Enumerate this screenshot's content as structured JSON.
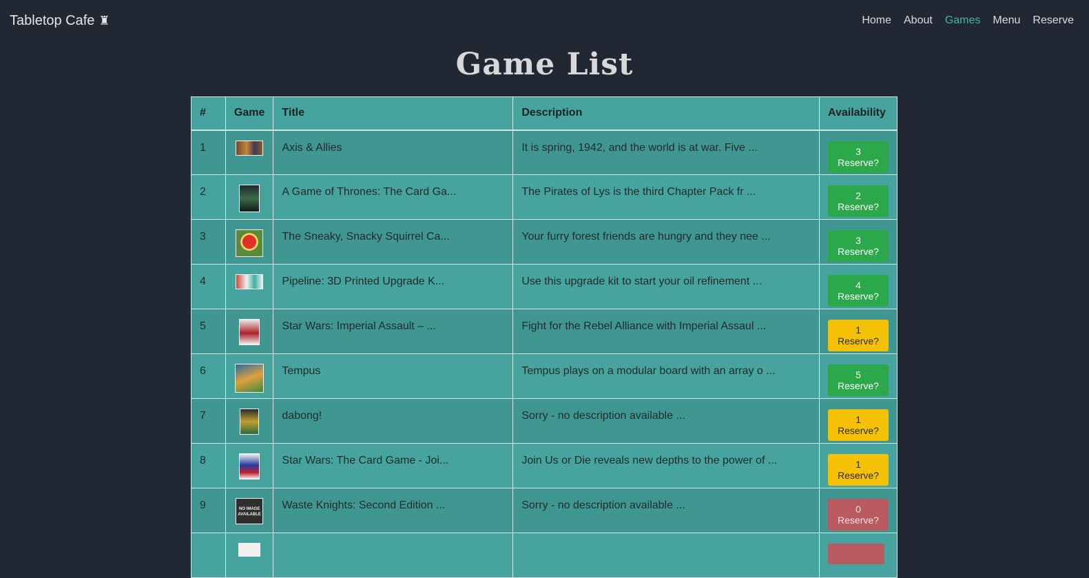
{
  "navbar": {
    "brand": "Tabletop Cafe",
    "brand_icon": "rook-castle-icon",
    "links": [
      "Home",
      "About",
      "Games",
      "Menu",
      "Reserve"
    ],
    "active": "Games"
  },
  "page_title": "Game List",
  "table": {
    "headers": [
      "#",
      "Game",
      "Title",
      "Description",
      "Availability"
    ],
    "rows": [
      {
        "num": "1",
        "title": "Axis & Allies",
        "description": "It is spring, 1942, and the world is at war. Five ...",
        "availability": "3 Reserve?",
        "status": "success"
      },
      {
        "num": "2",
        "title": "A Game of Thrones: The Card Ga...",
        "description": "The Pirates of Lys is the third Chapter Pack fr ...",
        "availability": "2 Reserve?",
        "status": "success"
      },
      {
        "num": "3",
        "title": "The Sneaky, Snacky Squirrel Ca...",
        "description": "Your furry forest friends are hungry and they nee ...",
        "availability": "3 Reserve?",
        "status": "success"
      },
      {
        "num": "4",
        "title": "Pipeline: 3D Printed Upgrade K...",
        "description": "Use this upgrade kit to start your oil refinement ...",
        "availability": "4 Reserve?",
        "status": "success"
      },
      {
        "num": "5",
        "title": "Star Wars: Imperial Assault – ...",
        "description": "Fight for the Rebel Alliance with Imperial Assaul ...",
        "availability": "1 Reserve?",
        "status": "warning"
      },
      {
        "num": "6",
        "title": "Tempus",
        "description": "Tempus plays on a modular board with an array o ...",
        "availability": "5 Reserve?",
        "status": "success"
      },
      {
        "num": "7",
        "title": "dabong!",
        "description": "Sorry - no description available ...",
        "availability": "1 Reserve?",
        "status": "warning"
      },
      {
        "num": "8",
        "title": "Star Wars: The Card Game - Joi...",
        "description": "Join Us or Die reveals new depths to the power of ...",
        "availability": "1 Reserve?",
        "status": "warning"
      },
      {
        "num": "9",
        "title": "Waste Knights: Second Edition ...",
        "description": "Sorry - no description available ...",
        "availability": "0 Reserve?",
        "status": "danger"
      },
      {
        "num": "",
        "title": "",
        "description": "",
        "availability": "",
        "status": "danger"
      }
    ]
  }
}
